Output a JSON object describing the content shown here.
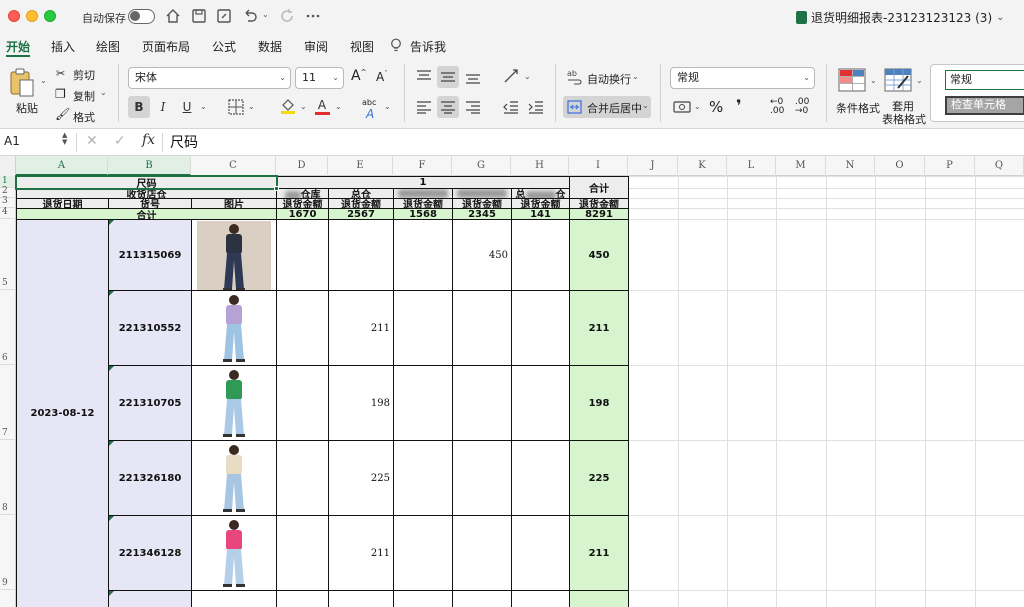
{
  "titlebar": {
    "autosave_label": "自动保存",
    "doc_title": "退货明细报表-23123123123 (3)",
    "doc_caret": "⌄"
  },
  "menu": {
    "tabs": [
      "开始",
      "插入",
      "绘图",
      "页面布局",
      "公式",
      "数据",
      "审阅",
      "视图"
    ],
    "tell_me": "告诉我"
  },
  "ribbon": {
    "paste": "粘贴",
    "cut": "剪切",
    "copy": "复制",
    "format_painter": "格式",
    "font_name": "宋体",
    "font_size": "11",
    "font_grow": "A",
    "font_shrink": "A",
    "bold": "B",
    "italic": "I",
    "underline": "U",
    "font_color_letter": "A",
    "phonetic": "abc",
    "wrap_text": "自动换行",
    "merge_center": "合并后居中",
    "number_format": "常规",
    "percent": "%",
    "comma": "❜",
    "dec_increase": ".00",
    "dec_decrease": ".00",
    "conditional_format": "条件格式",
    "table_format_1": "套用",
    "table_format_2": "表格格式",
    "style_normal": "常规",
    "style_check_cell": "检查单元格",
    "colors": {
      "fill": "#f5d90a",
      "font": "#e03030"
    }
  },
  "formula_bar": {
    "name_box": "A1",
    "cancel": "✕",
    "accept": "✓",
    "fx": "fx",
    "content": "尺码"
  },
  "sheet": {
    "columns": [
      "A",
      "B",
      "C",
      "D",
      "E",
      "F",
      "G",
      "H",
      "I",
      "J",
      "K",
      "L",
      "M",
      "N",
      "O",
      "P",
      "Q"
    ],
    "rows": [
      "1",
      "2",
      "3",
      "4",
      "5",
      "6",
      "7",
      "8",
      "9"
    ],
    "header": {
      "size_label": "尺码",
      "warehouse_label": "收货店仓",
      "size_value": "1",
      "total_header": "合计",
      "wh_d_suffix": "仓库",
      "wh_e": "总仓",
      "wh_h_prefix": "总",
      "wh_h_suffix": "仓"
    },
    "row3": [
      "退货日期",
      "货号",
      "图片",
      "退货金额",
      "退货金额",
      "退货金额",
      "退货金额",
      "退货金额",
      "退货金额"
    ],
    "row4": {
      "label": "合计",
      "D": "1670",
      "E": "2567",
      "F": "1568",
      "G": "2345",
      "H": "141",
      "I": "8291"
    },
    "date": "2023-08-12",
    "items": [
      {
        "sku": "211315069",
        "D": "",
        "E": "",
        "F": "",
        "G": "450",
        "H": "",
        "I": "450"
      },
      {
        "sku": "221310552",
        "D": "",
        "E": "211",
        "F": "",
        "G": "",
        "H": "",
        "I": "211"
      },
      {
        "sku": "221310705",
        "D": "",
        "E": "198",
        "F": "",
        "G": "",
        "H": "",
        "I": "198"
      },
      {
        "sku": "221326180",
        "D": "",
        "E": "225",
        "F": "",
        "G": "",
        "H": "",
        "I": "225"
      },
      {
        "sku": "221346128",
        "D": "",
        "E": "211",
        "F": "",
        "G": "",
        "H": "",
        "I": "211"
      }
    ],
    "product_colors": [
      {
        "top": "#2b3340",
        "bottom": "#2e3a55"
      },
      {
        "top": "#b7a2d6",
        "bottom": "#9ec3e3"
      },
      {
        "top": "#2e9a55",
        "bottom": "#a9c9e6"
      },
      {
        "top": "#e9dcc5",
        "bottom": "#a7c6e4"
      },
      {
        "top": "#e8467c",
        "bottom": "#b4cfe8"
      }
    ]
  }
}
